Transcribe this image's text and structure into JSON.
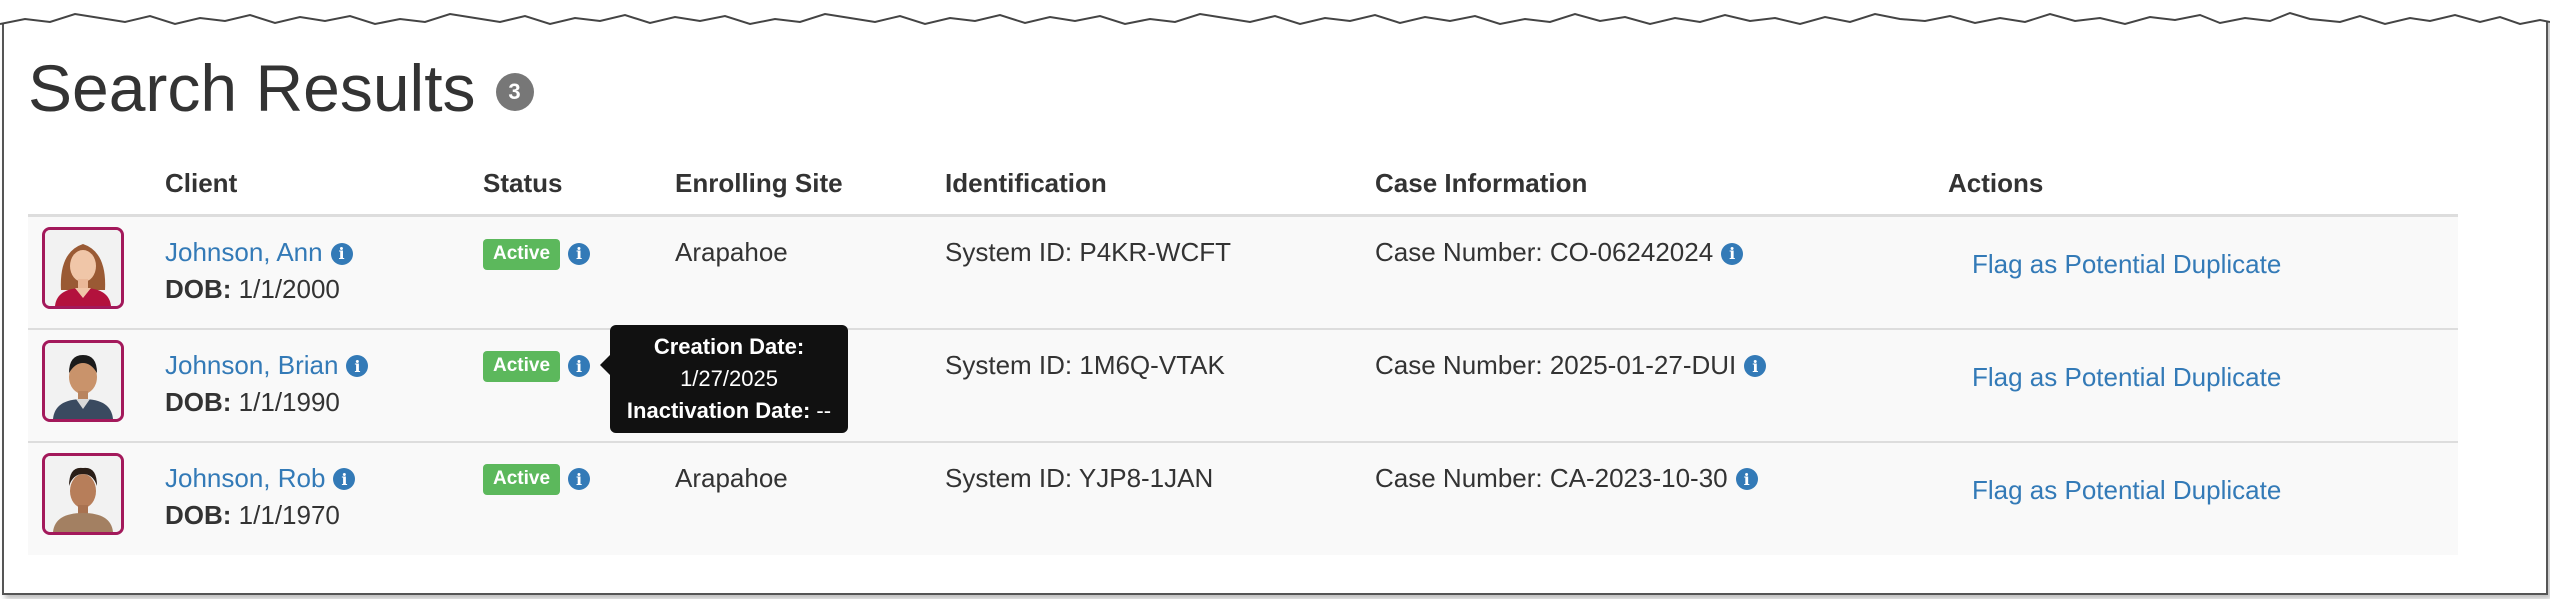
{
  "header": {
    "title": "Search Results",
    "count": "3"
  },
  "columns": {
    "client": "Client",
    "status": "Status",
    "enrolling_site": "Enrolling Site",
    "identification": "Identification",
    "case_information": "Case Information",
    "actions": "Actions"
  },
  "rows": [
    {
      "name": "Johnson, Ann",
      "dob_label": "DOB:",
      "dob": "1/1/2000",
      "status": "Active",
      "site": "Arapahoe",
      "identification": "System ID: P4KR-WCFT",
      "case": "Case Number: CO-06242024",
      "action": "Flag as Potential Duplicate"
    },
    {
      "name": "Johnson, Brian",
      "dob_label": "DOB:",
      "dob": "1/1/1990",
      "status": "Active",
      "site": "",
      "identification": "System ID: 1M6Q-VTAK",
      "case": "Case Number: 2025-01-27-DUI",
      "action": "Flag as Potential Duplicate"
    },
    {
      "name": "Johnson, Rob",
      "dob_label": "DOB:",
      "dob": "1/1/1970",
      "status": "Active",
      "site": "Arapahoe",
      "identification": "System ID: YJP8-1JAN",
      "case": "Case Number: CA-2023-10-30",
      "action": "Flag as Potential Duplicate"
    }
  ],
  "tooltip": {
    "creation_label": "Creation Date:",
    "creation_value": "1/27/2025",
    "inactivation_label": "Inactivation Date:",
    "inactivation_value": "--"
  },
  "colors": {
    "link": "#337ab7",
    "active": "#5cb85c",
    "avatar_border": "#a3195b",
    "badge": "#777777"
  }
}
